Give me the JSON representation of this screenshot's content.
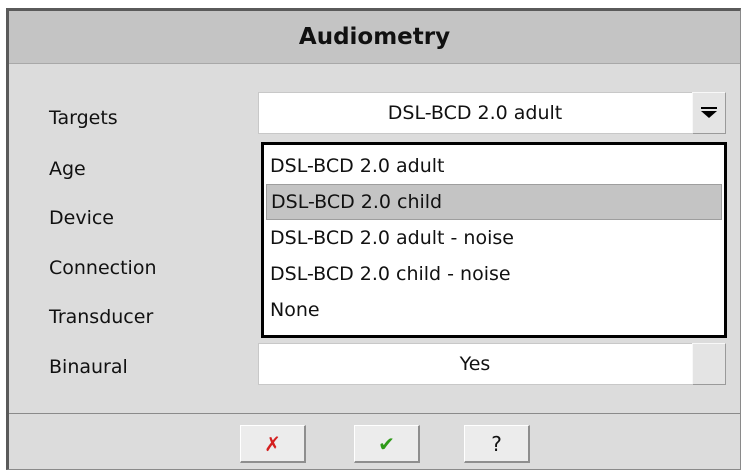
{
  "dialog": {
    "title": "Audiometry"
  },
  "rows": {
    "targets": {
      "label": "Targets",
      "value": "DSL-BCD 2.0 adult"
    },
    "age": {
      "label": "Age"
    },
    "device": {
      "label": "Device"
    },
    "connection": {
      "label": "Connection"
    },
    "transducer": {
      "label": "Transducer"
    },
    "binaural": {
      "label": "Binaural",
      "value": "Yes"
    }
  },
  "dropdown": {
    "items": [
      {
        "label": "DSL-BCD 2.0 adult",
        "selected": false
      },
      {
        "label": "DSL-BCD 2.0 child",
        "selected": true
      },
      {
        "label": "DSL-BCD 2.0 adult - noise",
        "selected": false
      },
      {
        "label": "DSL-BCD 2.0 child - noise",
        "selected": false
      },
      {
        "label": "None",
        "selected": false
      }
    ]
  },
  "buttons": {
    "cancel": {
      "glyph": "✗",
      "color": "#d42020"
    },
    "ok": {
      "glyph": "✔",
      "color": "#2e9a18"
    },
    "help": {
      "glyph": "?",
      "color": "#111111"
    }
  },
  "icons": {
    "combo_arrow": "chevron-down-icon"
  }
}
